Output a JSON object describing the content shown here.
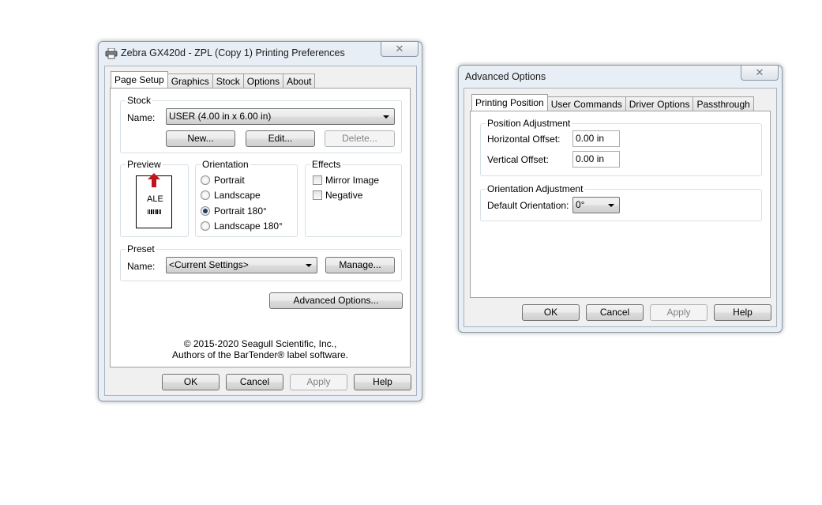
{
  "printing_prefs": {
    "title": "Zebra GX420d - ZPL (Copy 1) Printing Preferences",
    "tabs": [
      "Page Setup",
      "Graphics",
      "Stock",
      "Options",
      "About"
    ],
    "stock": {
      "group_label": "Stock",
      "name_label": "Name:",
      "name_value": "USER (4.00 in x 6.00 in)",
      "new_label": "New...",
      "edit_label": "Edit...",
      "delete_label": "Delete..."
    },
    "preview": {
      "group_label": "Preview",
      "sample_text": "ALE"
    },
    "orientation": {
      "group_label": "Orientation",
      "options": [
        "Portrait",
        "Landscape",
        "Portrait 180°",
        "Landscape 180°"
      ],
      "selected": "Portrait 180°"
    },
    "effects": {
      "group_label": "Effects",
      "mirror_label": "Mirror Image",
      "negative_label": "Negative"
    },
    "preset": {
      "group_label": "Preset",
      "name_label": "Name:",
      "name_value": "<Current Settings>",
      "manage_label": "Manage..."
    },
    "advanced_button": "Advanced Options...",
    "copyright_line1": "© 2015-2020 Seagull Scientific, Inc.,",
    "copyright_line2": "Authors of the BarTender® label software.",
    "footer": {
      "ok": "OK",
      "cancel": "Cancel",
      "apply": "Apply",
      "help": "Help"
    }
  },
  "advanced_options": {
    "title": "Advanced Options",
    "tabs": [
      "Printing Position",
      "User Commands",
      "Driver Options",
      "Passthrough"
    ],
    "position_adjustment": {
      "group_label": "Position Adjustment",
      "horizontal_label": "Horizontal Offset:",
      "horizontal_value": "0.00 in",
      "vertical_label": "Vertical Offset:",
      "vertical_value": "0.00 in"
    },
    "orientation_adjustment": {
      "group_label": "Orientation Adjustment",
      "default_label": "Default Orientation:",
      "default_value": "0°"
    },
    "footer": {
      "ok": "OK",
      "cancel": "Cancel",
      "apply": "Apply",
      "help": "Help"
    }
  },
  "colors": {
    "frame": "#e8eef6",
    "accent_arrow": "#c0161b"
  },
  "icons": {
    "title_icon": "printer-icon",
    "close": "close-icon",
    "dropdown": "chevron-down-icon",
    "preview_arrow": "arrow-up-icon"
  }
}
